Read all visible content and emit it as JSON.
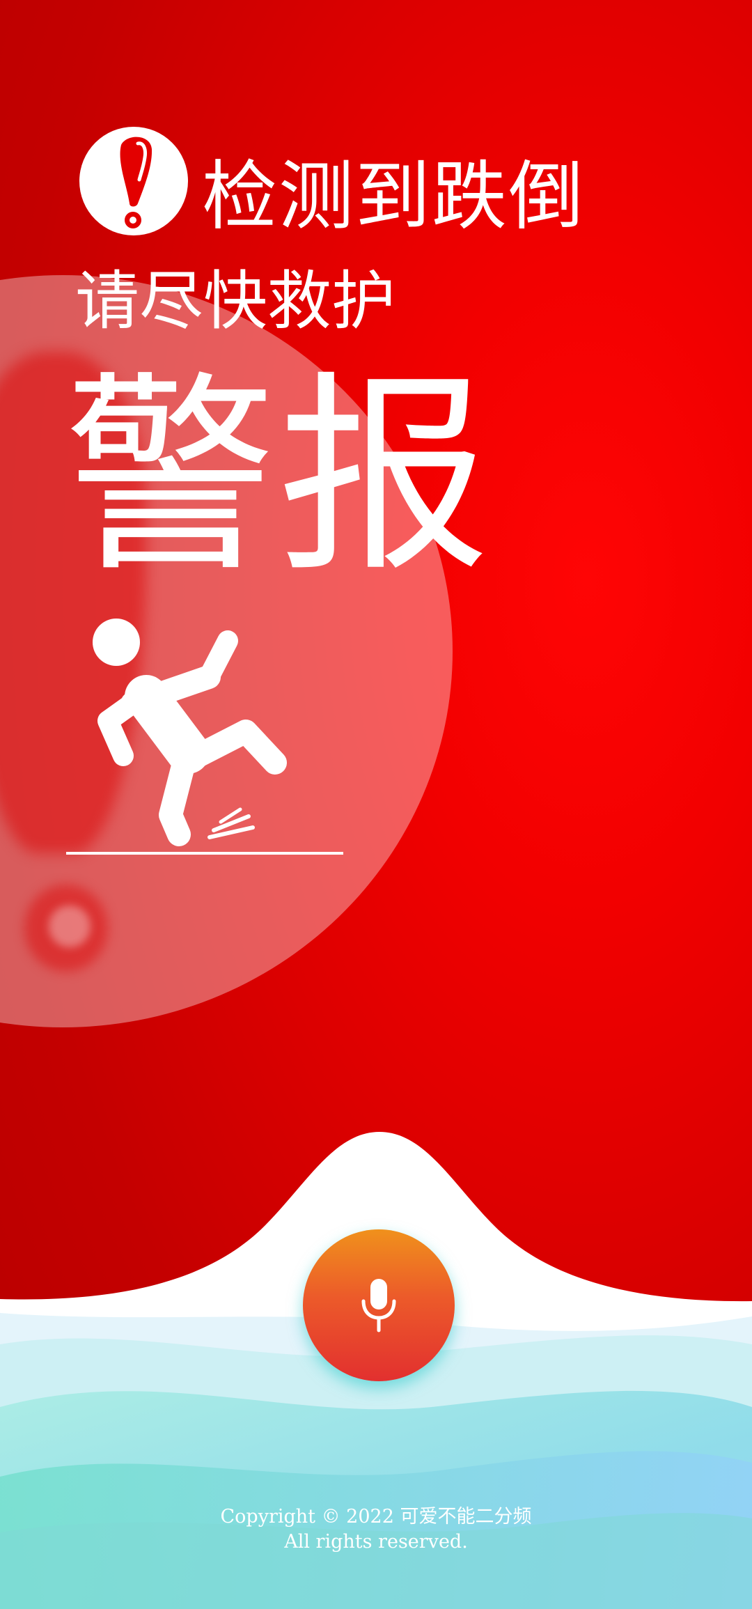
{
  "alert": {
    "icon": "exclamation-icon",
    "headline": "检测到跌倒",
    "subline": "请尽快救护",
    "title": "警报"
  },
  "illustration": {
    "icon": "person-falling-icon"
  },
  "controls": {
    "mic_icon": "microphone-icon"
  },
  "footer": {
    "copyright": "Copyright © 2022 可爱不能二分频",
    "rights": "All rights reserved."
  },
  "colors": {
    "alert_red": "#e00000",
    "mic_orange": "#f0911c",
    "mic_red": "#e2302f",
    "wave_teal": "#7fe3d8",
    "wave_blue": "#8ccff5"
  }
}
